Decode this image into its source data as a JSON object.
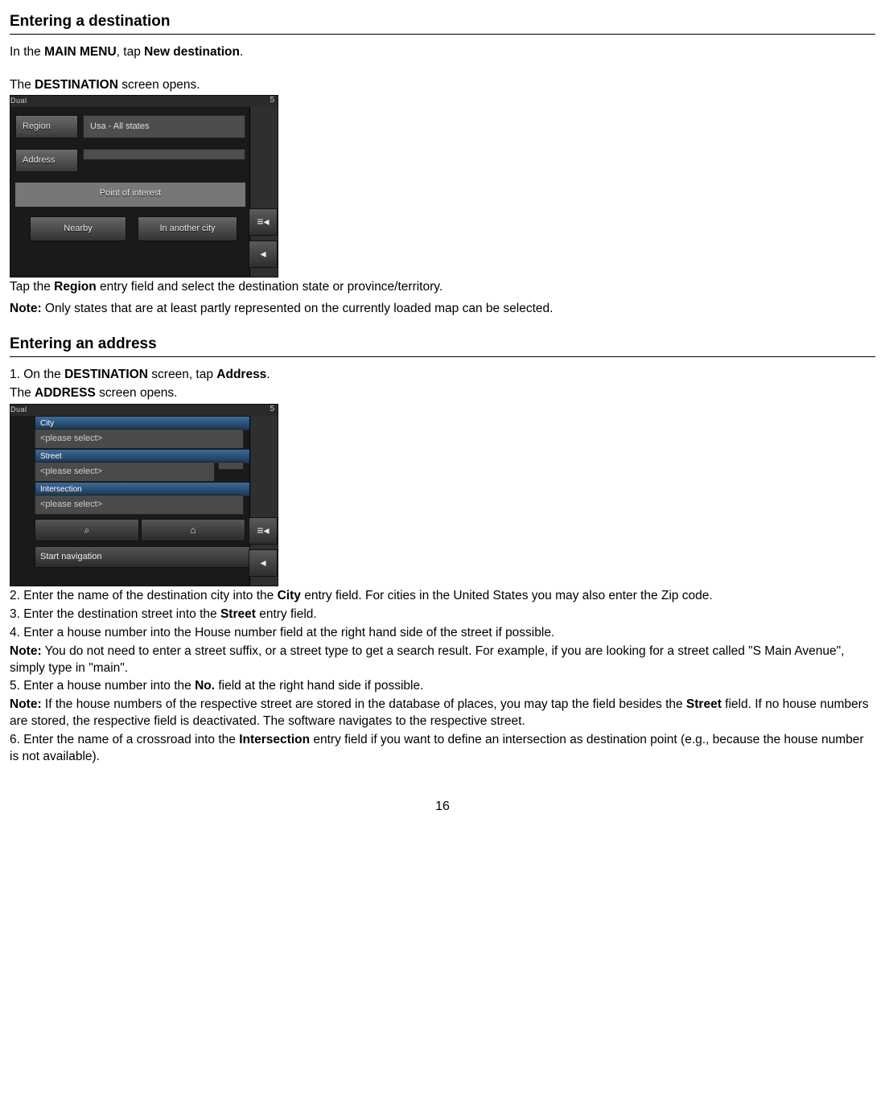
{
  "section1": {
    "heading": "Entering a destination",
    "p1_a": "In the ",
    "p1_b": "MAIN MENU",
    "p1_c": ", tap ",
    "p1_d": "New destination",
    "p1_e": ".",
    "p2_a": "The ",
    "p2_b": "DESTINATION",
    "p2_c": " screen opens.",
    "p3_a": "Tap the ",
    "p3_b": "Region",
    "p3_c": " entry field and select the destination state or province/territory.",
    "p4_a": "Note:",
    "p4_b": " Only states that are at least partly represented on the currently loaded map can be selected."
  },
  "shot1": {
    "corner": "Dual",
    "sat": "5",
    "region_label": "Region",
    "region_value": "Usa - All states",
    "address_label": "Address",
    "poi_label": "Point of interest",
    "nearby": "Nearby",
    "another": "In another city",
    "side1": "≡◂",
    "side2": "◂"
  },
  "section2": {
    "heading": "Entering an address",
    "l1_a": "1. On the ",
    "l1_b": "DESTINATION",
    "l1_c": " screen, tap ",
    "l1_d": "Address",
    "l1_e": ".",
    "l2_a": "The ",
    "l2_b": "ADDRESS",
    "l2_c": " screen opens."
  },
  "shot2": {
    "corner": "Dual",
    "sat": "5",
    "city_label": "City",
    "placeholder": "<please select>",
    "street_label": "Street",
    "inter_label": "Intersection",
    "search_icon": "⌕",
    "save_icon": "⌂",
    "start_nav": "Start navigation",
    "side1": "≡◂",
    "side2": "◂"
  },
  "section3": {
    "l3_a": "2. Enter the name of the destination city into the ",
    "l3_b": "City",
    "l3_c": " entry field. For cities in the United States you may also enter the Zip code.",
    "l4_a": "3. Enter the destination street into the ",
    "l4_b": "Street",
    "l4_c": " entry field.",
    "l5": "4. Enter a house number into the House number field at the right hand side of the street if possible.",
    "l6_a": "Note:",
    "l6_b": " You do not need to enter a street suffix, or a street type to get a search result. For example, if you are looking for a street called \"S Main Avenue\", simply type in \"main\".",
    "l7_a": "5. Enter a house number into the ",
    "l7_b": "No.",
    "l7_c": " field at the right hand side if possible.",
    "l8_a": "Note:",
    "l8_b": " If the house numbers of the respective street are stored in the database of places, you may tap the field besides the ",
    "l8_c": "Street",
    "l8_d": " field. If no house numbers are stored, the respective field is deactivated. The software navigates to the respective street.",
    "l9_a": "6. Enter the name of a crossroad into the ",
    "l9_b": "Intersection",
    "l9_c": " entry field if you want to define an intersection as destination point (e.g., because the house number is not available)."
  },
  "page_number": "16"
}
